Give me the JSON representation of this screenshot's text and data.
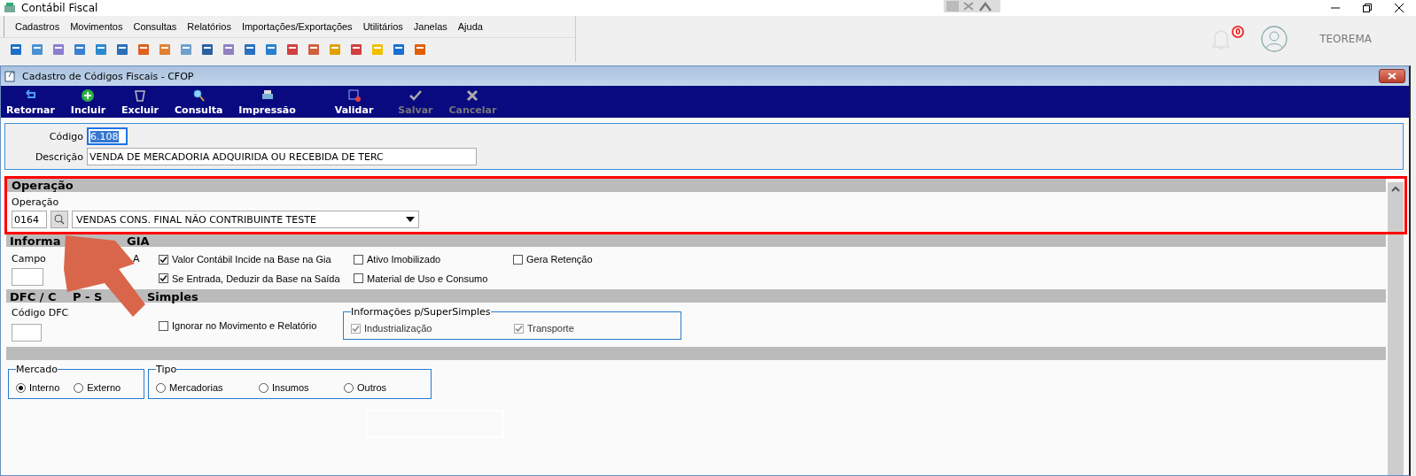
{
  "window": {
    "title": "Contábil Fiscal"
  },
  "menu": [
    "Cadastros",
    "Movimentos",
    "Consultas",
    "Relatórios",
    "Importações/Exportações",
    "Utilitários",
    "Janelas",
    "Ajuda"
  ],
  "header": {
    "notifications": "0",
    "user": "TEOREMA"
  },
  "child_window": {
    "title": "Cadastro de Códigos Fiscais - CFOP"
  },
  "actions": [
    {
      "kind": "back",
      "label": "Retornar",
      "disabled": false
    },
    {
      "kind": "add",
      "label": "Incluir",
      "disabled": false
    },
    {
      "kind": "delete",
      "label": "Excluir",
      "disabled": false
    },
    {
      "kind": "search",
      "label": "Consulta",
      "disabled": false
    },
    {
      "kind": "print",
      "label": "Impressão",
      "disabled": false
    },
    {
      "kind": "validate",
      "label": "Validar",
      "disabled": false
    },
    {
      "kind": "save",
      "label": "Salvar",
      "disabled": true
    },
    {
      "kind": "cancel",
      "label": "Cancelar",
      "disabled": true
    }
  ],
  "codigo": {
    "label": "Código",
    "value": "6.108",
    "selected": true
  },
  "descricao": {
    "label": "Descrição",
    "value": "VENDA DE MERCADORIA ADQUIRIDA OU RECEBIDA DE TERC"
  },
  "operacao": {
    "heading": "Operação",
    "label": "Operação",
    "code": "0164",
    "value": "VENDAS  CONS. FINAL NÃO CONTRIBUINTE TESTE"
  },
  "gia": {
    "heading": [
      "Informa",
      "GIA"
    ],
    "field_label": [
      "Campo",
      "A"
    ],
    "checkboxes": [
      {
        "label": "Valor Contábil Incide na Base na Gia",
        "checked": true,
        "disabled": false
      },
      {
        "label": "Ativo Imobilizado",
        "checked": false,
        "disabled": false
      },
      {
        "label": "Gera Retenção",
        "checked": false,
        "disabled": false
      },
      {
        "label": "Se Entrada, Deduzir da Base na Saída",
        "checked": true,
        "disabled": false
      },
      {
        "label": "Material de Uso e Consumo",
        "checked": false,
        "disabled": false
      }
    ]
  },
  "dfc": {
    "heading": [
      "DFC / C",
      "P - S",
      "Simples"
    ],
    "field_label": "Código DFC",
    "ignore": {
      "label": "Ignorar no Movimento e Relatório",
      "checked": false,
      "disabled": false
    },
    "group": {
      "title": "Informações p/SuperSimples",
      "checkboxes": [
        {
          "label": "Industrialização",
          "checked": true,
          "disabled": true
        },
        {
          "label": "Transporte",
          "checked": true,
          "disabled": true
        }
      ]
    }
  },
  "mercado": {
    "title": "Mercado",
    "options": [
      {
        "label": "Interno",
        "selected": true
      },
      {
        "label": "Externo",
        "selected": false
      }
    ]
  },
  "tipo": {
    "title": "Tipo",
    "options": [
      {
        "label": "Mercadorias",
        "selected": false
      },
      {
        "label": "Insumos",
        "selected": false
      },
      {
        "label": "Outros",
        "selected": false
      }
    ]
  }
}
